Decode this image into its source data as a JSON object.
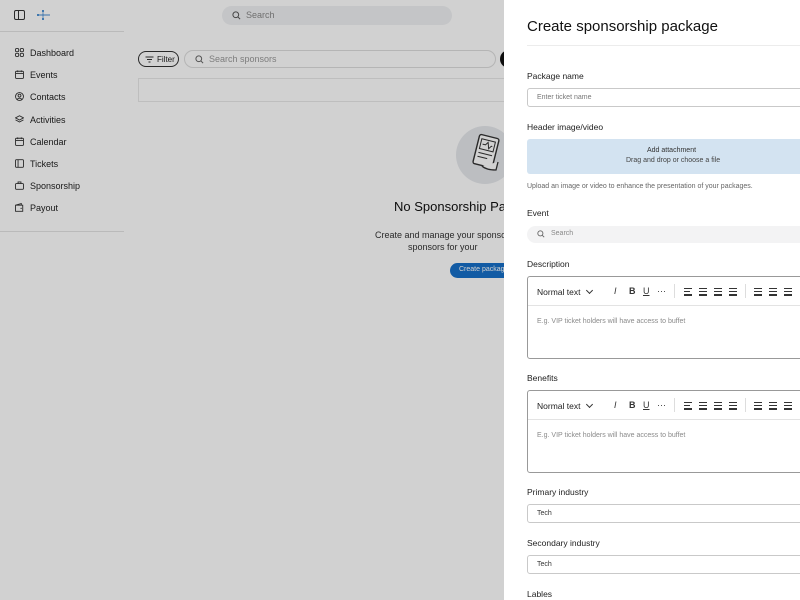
{
  "topbar": {
    "search_placeholder": "Search"
  },
  "sidebar": {
    "items": [
      {
        "label": "Dashboard",
        "icon": "grid-icon"
      },
      {
        "label": "Events",
        "icon": "calendar-icon"
      },
      {
        "label": "Contacts",
        "icon": "user-circle-icon"
      },
      {
        "label": "Activities",
        "icon": "layers-icon"
      },
      {
        "label": "Calendar",
        "icon": "calendar-icon"
      },
      {
        "label": "Tickets",
        "icon": "ticket-icon"
      },
      {
        "label": "Sponsorship",
        "icon": "briefcase-icon"
      },
      {
        "label": "Payout",
        "icon": "wallet-icon"
      }
    ]
  },
  "main": {
    "filter_label": "Filter",
    "search_placeholder": "Search sponsors",
    "empty_title": "No Sponsorship Pac",
    "empty_desc_line1": "Create and manage your sponsors",
    "empty_desc_line2": "sponsors for your",
    "create_button": "Create packag"
  },
  "drawer": {
    "title": "Create sponsorship package",
    "package_name": {
      "label": "Package name",
      "placeholder": "Enter ticket name"
    },
    "header_media": {
      "label": "Header image/video",
      "attach_title": "Add attachment",
      "attach_sub": "Drag and drop or choose a file",
      "helper": "Upload an image or video to enhance the presentation of your packages."
    },
    "event": {
      "label": "Event",
      "placeholder": "Search"
    },
    "description": {
      "label": "Description",
      "format": "Normal text",
      "placeholder": "E.g. VIP ticket holders will have access to buffet"
    },
    "benefits": {
      "label": "Benefits",
      "format": "Normal text",
      "placeholder": "E.g. VIP ticket holders will have access to buffet"
    },
    "primary_industry": {
      "label": "Primary industry",
      "value": "Tech"
    },
    "secondary_industry": {
      "label": "Secondary industry",
      "value": "Tech"
    },
    "labels": {
      "label": "Lables"
    }
  },
  "colors": {
    "accent": "#1770c8",
    "attachment_bg": "#d3e3f1"
  }
}
